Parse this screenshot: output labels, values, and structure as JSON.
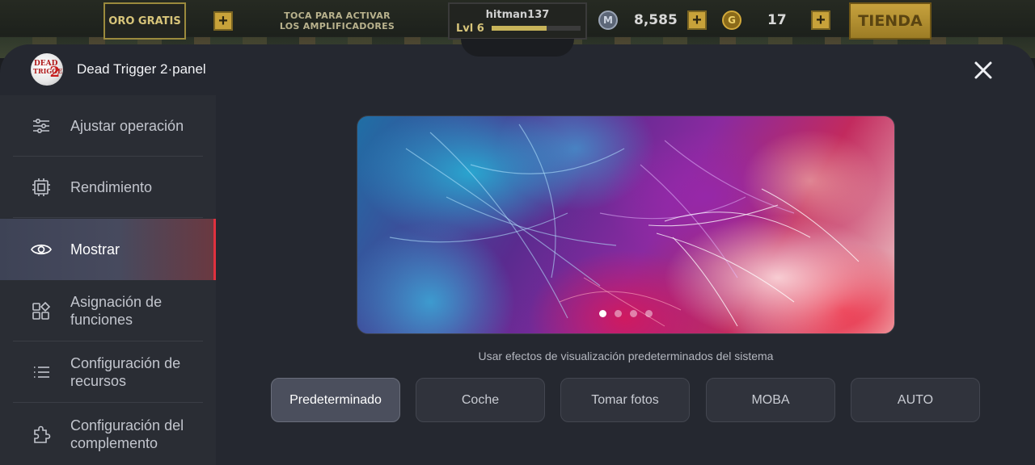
{
  "hud": {
    "oro_gratis": "ORO GRATIS",
    "amplifier_line1": "TOCA PARA ACTIVAR",
    "amplifier_line2": "LOS AMPLIFICADORES",
    "player_name": "hitman137",
    "player_level": "Lvl 6",
    "xp_progress": 0.62,
    "money": "8,585",
    "money_icon": "M",
    "gold": "17",
    "gold_icon": "G",
    "shop_label": "TIENDA",
    "plus": "+"
  },
  "panel": {
    "title": "Dead Trigger 2·panel",
    "logo": {
      "line1": "DEAD",
      "line2": "TRIGGER",
      "mark": "2"
    }
  },
  "sidebar": {
    "items": [
      {
        "label": "Ajustar operación",
        "icon": "sliders-icon",
        "active": false
      },
      {
        "label": "Rendimiento",
        "icon": "chip-icon",
        "active": false
      },
      {
        "label": "Mostrar",
        "icon": "eye-icon",
        "active": true
      },
      {
        "label": "Asignación de funciones",
        "icon": "grid-shapes-icon",
        "active": false
      },
      {
        "label": "Configuración de recursos",
        "icon": "list-icon",
        "active": false
      },
      {
        "label": "Configuración del complemento",
        "icon": "puzzle-icon",
        "active": false
      }
    ]
  },
  "main": {
    "carousel": {
      "pages": 4,
      "current": 1
    },
    "caption": "Usar efectos de visualización predeterminados del sistema",
    "modes": [
      {
        "label": "Predeterminado",
        "active": true
      },
      {
        "label": "Coche",
        "active": false
      },
      {
        "label": "Tomar fotos",
        "active": false
      },
      {
        "label": "MOBA",
        "active": false
      },
      {
        "label": "AUTO",
        "active": false
      }
    ]
  }
}
